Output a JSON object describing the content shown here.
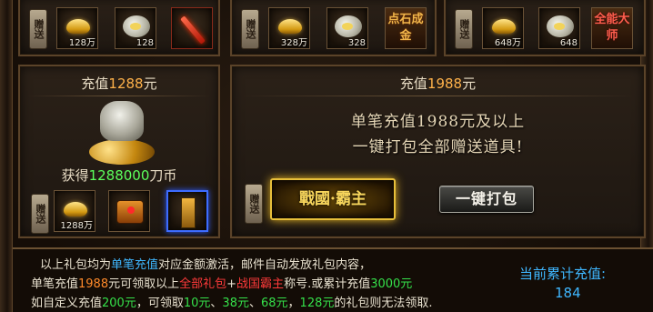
{
  "top_row": {
    "panel1": {
      "gift_tag": "赠送",
      "slot1_qty": "128万",
      "slot2_qty": "128"
    },
    "panel2": {
      "gift_tag": "赠送",
      "title_text": "点石成金",
      "slot1_qty": "328万",
      "slot2_qty": "328"
    },
    "panel3": {
      "gift_tag": "赠送",
      "slot1_qty": "648万",
      "slot2_qty": "648",
      "title_text": "全能大师"
    }
  },
  "left_panel": {
    "title_prefix": "充值",
    "title_amount": "1288",
    "title_suffix": "元",
    "obtain_prefix": "获得",
    "obtain_amount": "1288000",
    "obtain_suffix": "刀币",
    "gift_tag": "赠送",
    "slot1_qty": "1288万"
  },
  "right_panel": {
    "title_prefix": "充值",
    "title_amount": "1988",
    "title_suffix": "元",
    "promo_line1": "单笔充值1988元及以上",
    "promo_line2": "一键打包全部赠送道具!",
    "gift_tag": "赠送",
    "badge_text": "戰國·霸主",
    "pack_button": "一键打包"
  },
  "info": {
    "line1": {
      "p1": "以上礼包均为",
      "p2": "单笔充值",
      "p3": "对应金额激活，邮件自动发放礼包内容，"
    },
    "line2": {
      "p1": "单笔充值",
      "p2": "1988",
      "p3": "元可领取以上",
      "p4": "全部礼包",
      "p5": "+",
      "p6": "战国霸主",
      "p7": "称号.或累计充值",
      "p8": "3000元"
    },
    "line3": {
      "p1": "如自定义充值",
      "p2": "200元",
      "p3": "，可领取",
      "p4": "10元",
      "p5": "、",
      "p6": "38元",
      "p7": "、",
      "p8": "68元",
      "p9": "，",
      "p10": "128元",
      "p11": "的礼包则无法领取."
    },
    "cumulative_label": "当前累计充值:",
    "cumulative_value": "184"
  }
}
